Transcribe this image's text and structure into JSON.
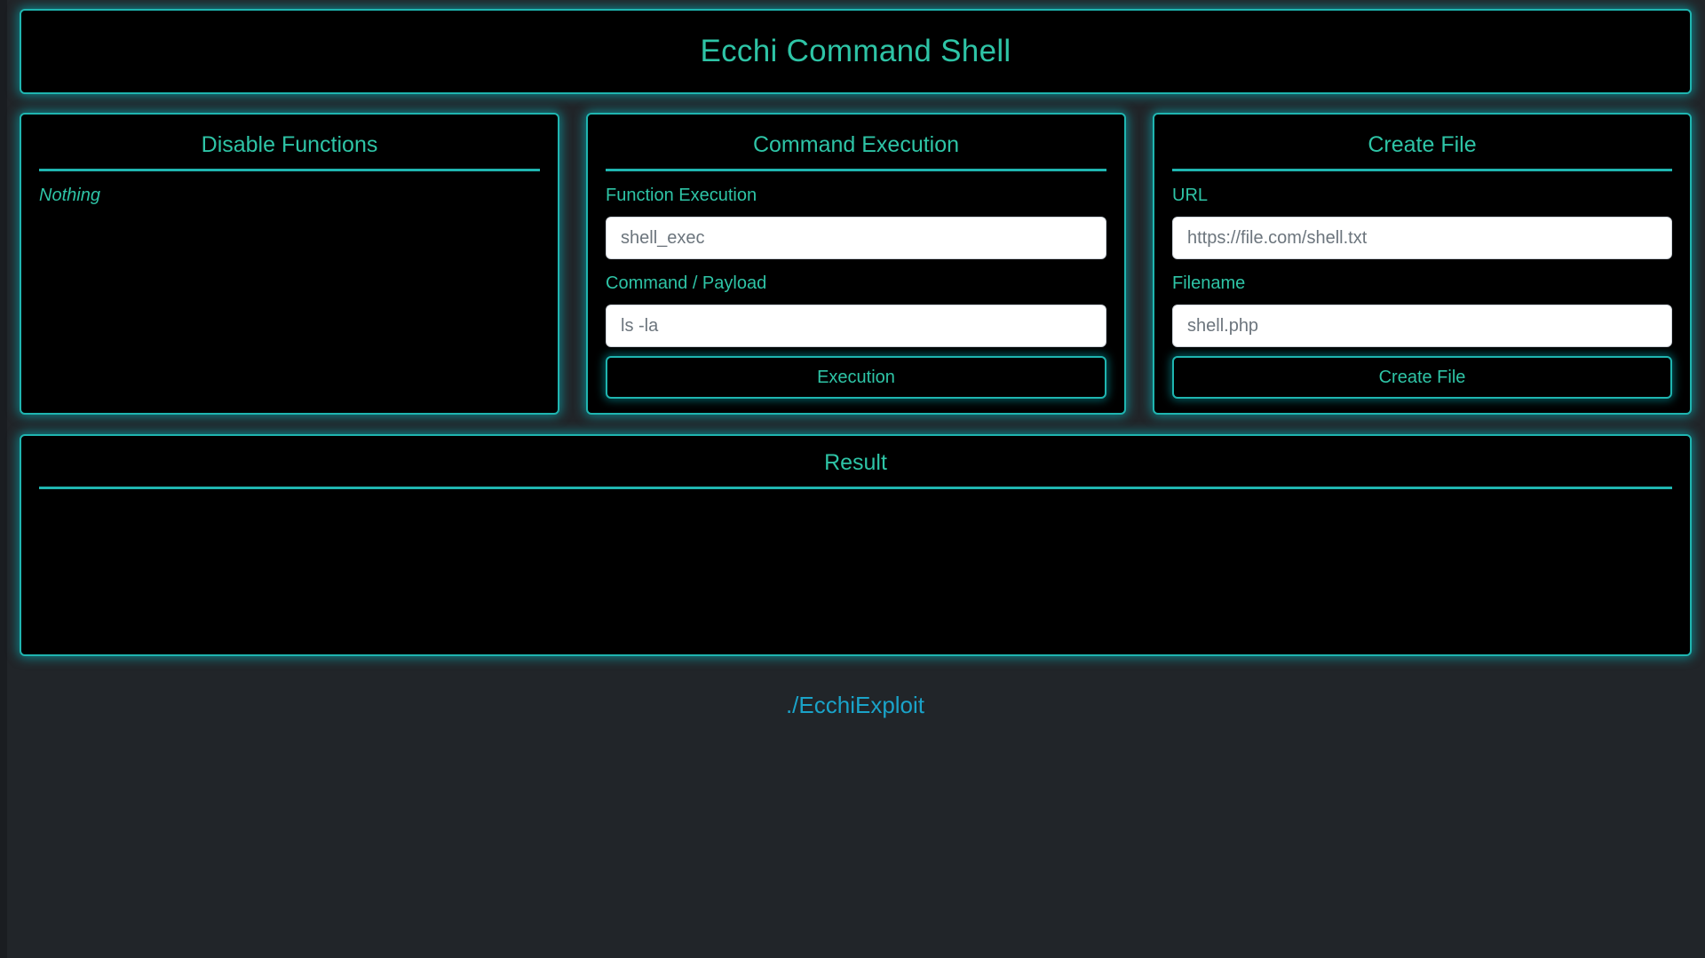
{
  "header": {
    "title": "Ecchi Command Shell"
  },
  "disable_functions": {
    "title": "Disable Functions",
    "value": "Nothing"
  },
  "command_execution": {
    "title": "Command Execution",
    "function_label": "Function Execution",
    "function_placeholder": "shell_exec",
    "command_label": "Command / Payload",
    "command_placeholder": "ls -la",
    "button_label": "Execution"
  },
  "create_file": {
    "title": "Create File",
    "url_label": "URL",
    "url_placeholder": "https://file.com/shell.txt",
    "filename_label": "Filename",
    "filename_placeholder": "shell.php",
    "button_label": "Create File"
  },
  "result": {
    "title": "Result",
    "output": ""
  },
  "footer": {
    "link_text": "./EcchiExploit"
  },
  "colors": {
    "accent": "#1fb5b0",
    "text_accent": "#2ec4a6",
    "link": "#1aa3c9",
    "background": "#212529",
    "panel": "#000000"
  }
}
